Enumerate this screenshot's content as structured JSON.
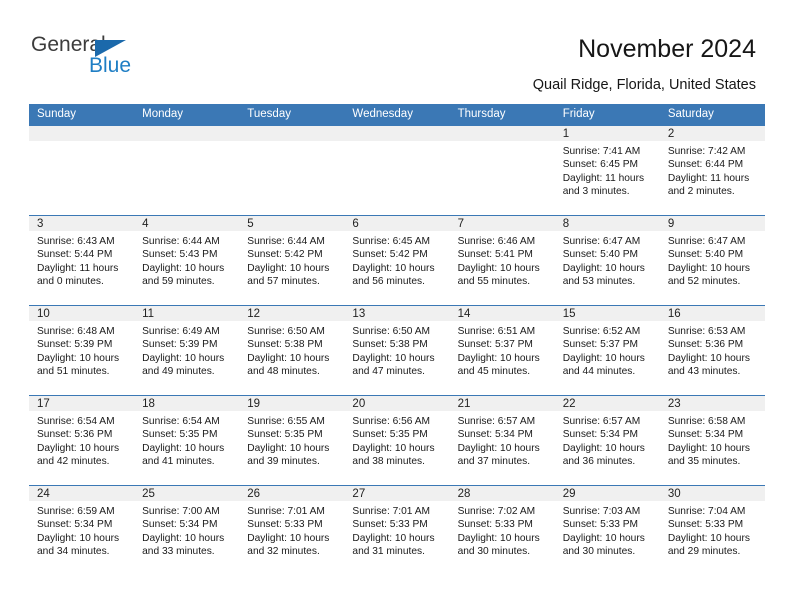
{
  "brand": {
    "name_part1": "General",
    "name_part2": "Blue",
    "triangle_color": "#1b69ab",
    "blue_text_color": "#1f7ec4"
  },
  "header": {
    "title": "November 2024",
    "subtitle": "Quail Ridge, Florida, United States"
  },
  "colors": {
    "header_blue": "#3b78b5",
    "daynum_band": "#f0f0f0",
    "row_separator": "#3b78b5"
  },
  "weekday_headers": [
    "Sunday",
    "Monday",
    "Tuesday",
    "Wednesday",
    "Thursday",
    "Friday",
    "Saturday"
  ],
  "labels": {
    "sunrise_prefix": "Sunrise:",
    "sunset_prefix": "Sunset:",
    "daylight_prefix": "Daylight:"
  },
  "weeks": [
    [
      {
        "day": "",
        "line1": "",
        "line2": "",
        "line3": "",
        "line4": "",
        "empty": true
      },
      {
        "day": "",
        "line1": "",
        "line2": "",
        "line3": "",
        "line4": "",
        "empty": true
      },
      {
        "day": "",
        "line1": "",
        "line2": "",
        "line3": "",
        "line4": "",
        "empty": true
      },
      {
        "day": "",
        "line1": "",
        "line2": "",
        "line3": "",
        "line4": "",
        "empty": true
      },
      {
        "day": "",
        "line1": "",
        "line2": "",
        "line3": "",
        "line4": "",
        "empty": true
      },
      {
        "day": "1",
        "line1": "Sunrise: 7:41 AM",
        "line2": "Sunset: 6:45 PM",
        "line3": "Daylight: 11 hours",
        "line4": "and 3 minutes.",
        "empty": false
      },
      {
        "day": "2",
        "line1": "Sunrise: 7:42 AM",
        "line2": "Sunset: 6:44 PM",
        "line3": "Daylight: 11 hours",
        "line4": "and 2 minutes.",
        "empty": false
      }
    ],
    [
      {
        "day": "3",
        "line1": "Sunrise: 6:43 AM",
        "line2": "Sunset: 5:44 PM",
        "line3": "Daylight: 11 hours",
        "line4": "and 0 minutes.",
        "empty": false
      },
      {
        "day": "4",
        "line1": "Sunrise: 6:44 AM",
        "line2": "Sunset: 5:43 PM",
        "line3": "Daylight: 10 hours",
        "line4": "and 59 minutes.",
        "empty": false
      },
      {
        "day": "5",
        "line1": "Sunrise: 6:44 AM",
        "line2": "Sunset: 5:42 PM",
        "line3": "Daylight: 10 hours",
        "line4": "and 57 minutes.",
        "empty": false
      },
      {
        "day": "6",
        "line1": "Sunrise: 6:45 AM",
        "line2": "Sunset: 5:42 PM",
        "line3": "Daylight: 10 hours",
        "line4": "and 56 minutes.",
        "empty": false
      },
      {
        "day": "7",
        "line1": "Sunrise: 6:46 AM",
        "line2": "Sunset: 5:41 PM",
        "line3": "Daylight: 10 hours",
        "line4": "and 55 minutes.",
        "empty": false
      },
      {
        "day": "8",
        "line1": "Sunrise: 6:47 AM",
        "line2": "Sunset: 5:40 PM",
        "line3": "Daylight: 10 hours",
        "line4": "and 53 minutes.",
        "empty": false
      },
      {
        "day": "9",
        "line1": "Sunrise: 6:47 AM",
        "line2": "Sunset: 5:40 PM",
        "line3": "Daylight: 10 hours",
        "line4": "and 52 minutes.",
        "empty": false
      }
    ],
    [
      {
        "day": "10",
        "line1": "Sunrise: 6:48 AM",
        "line2": "Sunset: 5:39 PM",
        "line3": "Daylight: 10 hours",
        "line4": "and 51 minutes.",
        "empty": false
      },
      {
        "day": "11",
        "line1": "Sunrise: 6:49 AM",
        "line2": "Sunset: 5:39 PM",
        "line3": "Daylight: 10 hours",
        "line4": "and 49 minutes.",
        "empty": false
      },
      {
        "day": "12",
        "line1": "Sunrise: 6:50 AM",
        "line2": "Sunset: 5:38 PM",
        "line3": "Daylight: 10 hours",
        "line4": "and 48 minutes.",
        "empty": false
      },
      {
        "day": "13",
        "line1": "Sunrise: 6:50 AM",
        "line2": "Sunset: 5:38 PM",
        "line3": "Daylight: 10 hours",
        "line4": "and 47 minutes.",
        "empty": false
      },
      {
        "day": "14",
        "line1": "Sunrise: 6:51 AM",
        "line2": "Sunset: 5:37 PM",
        "line3": "Daylight: 10 hours",
        "line4": "and 45 minutes.",
        "empty": false
      },
      {
        "day": "15",
        "line1": "Sunrise: 6:52 AM",
        "line2": "Sunset: 5:37 PM",
        "line3": "Daylight: 10 hours",
        "line4": "and 44 minutes.",
        "empty": false
      },
      {
        "day": "16",
        "line1": "Sunrise: 6:53 AM",
        "line2": "Sunset: 5:36 PM",
        "line3": "Daylight: 10 hours",
        "line4": "and 43 minutes.",
        "empty": false
      }
    ],
    [
      {
        "day": "17",
        "line1": "Sunrise: 6:54 AM",
        "line2": "Sunset: 5:36 PM",
        "line3": "Daylight: 10 hours",
        "line4": "and 42 minutes.",
        "empty": false
      },
      {
        "day": "18",
        "line1": "Sunrise: 6:54 AM",
        "line2": "Sunset: 5:35 PM",
        "line3": "Daylight: 10 hours",
        "line4": "and 41 minutes.",
        "empty": false
      },
      {
        "day": "19",
        "line1": "Sunrise: 6:55 AM",
        "line2": "Sunset: 5:35 PM",
        "line3": "Daylight: 10 hours",
        "line4": "and 39 minutes.",
        "empty": false
      },
      {
        "day": "20",
        "line1": "Sunrise: 6:56 AM",
        "line2": "Sunset: 5:35 PM",
        "line3": "Daylight: 10 hours",
        "line4": "and 38 minutes.",
        "empty": false
      },
      {
        "day": "21",
        "line1": "Sunrise: 6:57 AM",
        "line2": "Sunset: 5:34 PM",
        "line3": "Daylight: 10 hours",
        "line4": "and 37 minutes.",
        "empty": false
      },
      {
        "day": "22",
        "line1": "Sunrise: 6:57 AM",
        "line2": "Sunset: 5:34 PM",
        "line3": "Daylight: 10 hours",
        "line4": "and 36 minutes.",
        "empty": false
      },
      {
        "day": "23",
        "line1": "Sunrise: 6:58 AM",
        "line2": "Sunset: 5:34 PM",
        "line3": "Daylight: 10 hours",
        "line4": "and 35 minutes.",
        "empty": false
      }
    ],
    [
      {
        "day": "24",
        "line1": "Sunrise: 6:59 AM",
        "line2": "Sunset: 5:34 PM",
        "line3": "Daylight: 10 hours",
        "line4": "and 34 minutes.",
        "empty": false
      },
      {
        "day": "25",
        "line1": "Sunrise: 7:00 AM",
        "line2": "Sunset: 5:34 PM",
        "line3": "Daylight: 10 hours",
        "line4": "and 33 minutes.",
        "empty": false
      },
      {
        "day": "26",
        "line1": "Sunrise: 7:01 AM",
        "line2": "Sunset: 5:33 PM",
        "line3": "Daylight: 10 hours",
        "line4": "and 32 minutes.",
        "empty": false
      },
      {
        "day": "27",
        "line1": "Sunrise: 7:01 AM",
        "line2": "Sunset: 5:33 PM",
        "line3": "Daylight: 10 hours",
        "line4": "and 31 minutes.",
        "empty": false
      },
      {
        "day": "28",
        "line1": "Sunrise: 7:02 AM",
        "line2": "Sunset: 5:33 PM",
        "line3": "Daylight: 10 hours",
        "line4": "and 30 minutes.",
        "empty": false
      },
      {
        "day": "29",
        "line1": "Sunrise: 7:03 AM",
        "line2": "Sunset: 5:33 PM",
        "line3": "Daylight: 10 hours",
        "line4": "and 30 minutes.",
        "empty": false
      },
      {
        "day": "30",
        "line1": "Sunrise: 7:04 AM",
        "line2": "Sunset: 5:33 PM",
        "line3": "Daylight: 10 hours",
        "line4": "and 29 minutes.",
        "empty": false
      }
    ]
  ]
}
